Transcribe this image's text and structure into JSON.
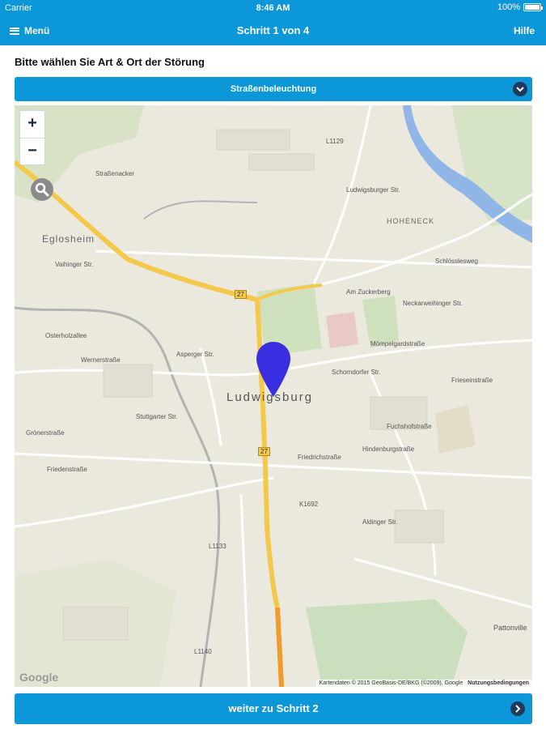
{
  "status_bar": {
    "carrier": "Carrier",
    "time": "8:46 AM",
    "battery": "100%"
  },
  "nav": {
    "menu_label": "Menü",
    "title": "Schritt 1 von 4",
    "help_label": "Hilfe"
  },
  "prompt": "Bitte wählen Sie Art & Ort der Störung",
  "category_select": {
    "selected": "Straßenbeleuchtung"
  },
  "map": {
    "zoom_in": "+",
    "zoom_out": "−",
    "city_label": "Ludwigsburg",
    "district_labels": [
      "Eglosheim",
      "HOHENECK"
    ],
    "street_labels": [
      "Straßenacker",
      "Ludwigsburger Str.",
      "Vaihinger Str.",
      "Schlösslesweg",
      "Am Zuckerberg",
      "Asperger Str.",
      "Schorndorfer Str.",
      "Friedrichstraße",
      "Grönerstraße",
      "Wernerstraße",
      "Osterholzallee",
      "Friedenstraße",
      "Mömpelgardstraße",
      "Neckarweihinger Str.",
      "K1692",
      "Aldinger Str.",
      "Fuchshofstraße",
      "Hindenburgstraße",
      "Stuttgarter Str.",
      "Frieseinstraße",
      "L1129",
      "L1140",
      "L1133",
      "Pattonville"
    ],
    "road_badges": [
      "27",
      "27"
    ],
    "google_logo": "Google",
    "attribution": "Kartendaten © 2015 GeoBasis-DE/BKG (©2009), Google",
    "terms": "Nutzungsbedingungen"
  },
  "next_button": {
    "label": "weiter zu Schritt 2"
  },
  "colors": {
    "brand_blue": "#0b97d8",
    "pin": "#3a2fe0",
    "highway": "#f4c84a"
  }
}
